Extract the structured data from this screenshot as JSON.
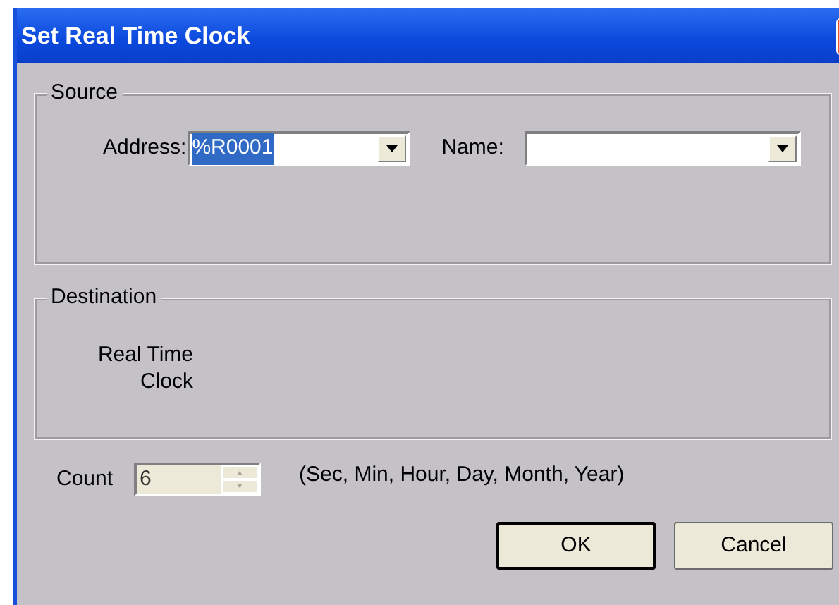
{
  "window": {
    "title": "Set Real Time Clock"
  },
  "source": {
    "legend": "Source",
    "address": {
      "label": "Address:",
      "value": "%R0001",
      "selected": true
    },
    "name": {
      "label": "Name:"
    }
  },
  "destination": {
    "legend": "Destination",
    "lines": [
      "Real Time",
      "Clock"
    ]
  },
  "count": {
    "label": "Count",
    "value": "6",
    "disabled": true
  },
  "count_hint": "(Sec, Min, Hour, Day, Month, Year)",
  "buttons": [
    {
      "label": "OK",
      "default": true
    },
    {
      "label": "Cancel",
      "default": false
    }
  ]
}
